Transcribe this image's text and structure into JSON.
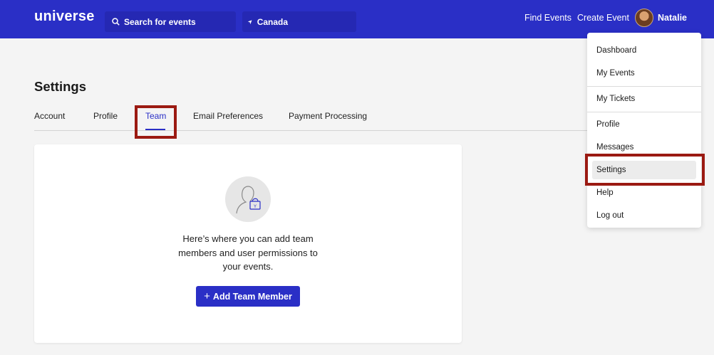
{
  "header": {
    "logo": "universe",
    "search_placeholder": "Search for events",
    "location": "Canada",
    "find_events": "Find Events",
    "create_event": "Create Event",
    "user_name": "Natalie"
  },
  "settings": {
    "title": "Settings",
    "tabs": [
      "Account",
      "Profile",
      "Team",
      "Email Preferences",
      "Payment Processing"
    ],
    "active_tab": "Team"
  },
  "team": {
    "empty_text": "Here’s where you can add team members and user permissions to your events.",
    "add_button": "Add Team Member"
  },
  "user_menu": {
    "items": [
      "Dashboard",
      "My Events",
      "My Tickets",
      "Profile",
      "Messages",
      "Settings",
      "Help",
      "Log out"
    ],
    "selected": "Settings"
  },
  "colors": {
    "brand": "#2a2fc6",
    "highlight": "#9b1a12"
  }
}
